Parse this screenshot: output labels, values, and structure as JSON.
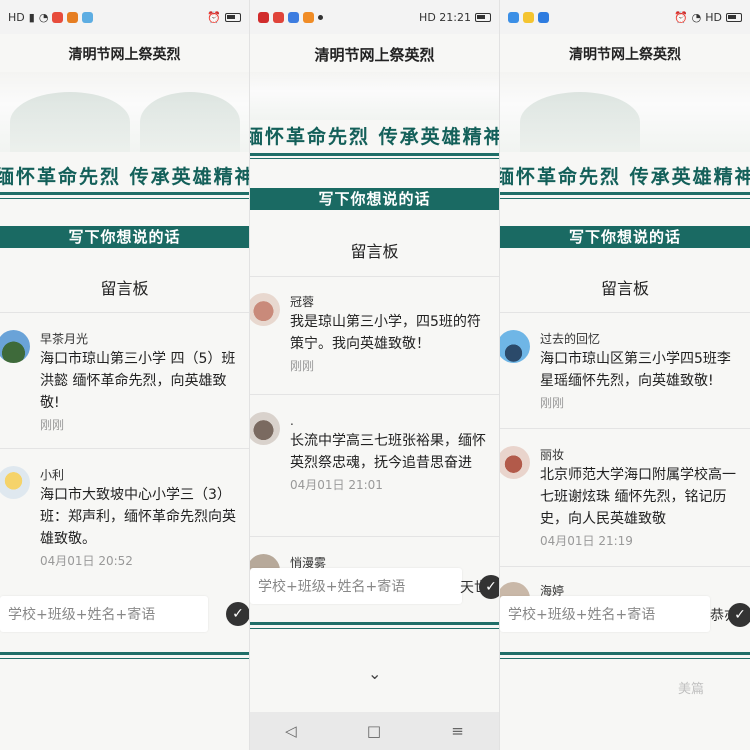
{
  "panel1": {
    "status": {
      "left": "HD",
      "right": ""
    },
    "app_title": "清明节网上祭英烈",
    "banner": "缅怀革命先烈  传承英雄精神",
    "write_bar": "写下你想说的话",
    "board_title": "留言板",
    "messages": [
      {
        "nick": "早茶月光",
        "body": "海口市琼山第三小学 四（5）班 洪懿 缅怀革命先烈，向英雄致敬!",
        "time": "刚刚"
      },
      {
        "nick": "小利",
        "body": "海口市大致坡中心小学三（3）班：郑声利，缅怀革命先烈向英雄致敬。",
        "time": "04月01日 20:52"
      }
    ],
    "input_placeholder": "学校+班级+姓名+寄语"
  },
  "panel2": {
    "status": {
      "left": "",
      "right": "HD 21:21"
    },
    "app_title": "清明节网上祭英烈",
    "banner": "缅怀革命先烈  传承英雄精神",
    "write_bar": "写下你想说的话",
    "board_title": "留言板",
    "messages": [
      {
        "nick": "冠蓉",
        "body": "我是琼山第三小学，四5班的符策宁。我向英雄致敬！",
        "time": "刚刚"
      },
      {
        "nick": ".",
        "body": "长流中学高三七班张裕果，缅怀英烈祭忠魂，抚今追昔思奋进",
        "time": "04月01日 21:01"
      },
      {
        "nick": "悄漫雾",
        "body": "",
        "time": ""
      }
    ],
    "input_placeholder": "学校+班级+姓名+寄语",
    "input_trailing": "天世"
  },
  "panel3": {
    "status": {
      "left": "",
      "right": "HD"
    },
    "app_title": "清明节网上祭英烈",
    "banner": "缅怀革命先烈  传承英雄精神",
    "write_bar": "写下你想说的话",
    "board_title": "留言板",
    "messages": [
      {
        "nick": "过去的回忆",
        "body": "海口市琼山区第三小学四5班李星瑶缅怀先烈，向英雄致敬!",
        "time": "刚刚"
      },
      {
        "nick": "丽妆",
        "body": "北京师范大学海口附属学校高一七班谢炫珠 缅怀先烈，铭记历史，向人民英雄致敬",
        "time": "04月01日 21:19"
      },
      {
        "nick": "海婷",
        "body": "",
        "time": ""
      }
    ],
    "input_placeholder": "学校+班级+姓名+寄语",
    "input_trailing": "恭亦"
  },
  "watermark": "美篇",
  "icons": [
    "check-icon",
    "back-icon",
    "home-icon",
    "menu-icon",
    "wifi-icon",
    "battery-icon"
  ],
  "colors": {
    "teal": "#1a6a63",
    "banner_text": "#14605a"
  }
}
